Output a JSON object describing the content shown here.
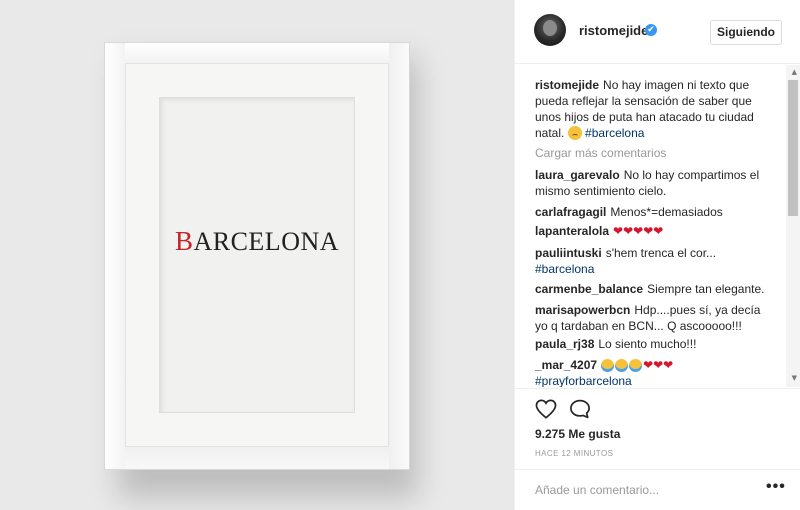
{
  "photo": {
    "artwork_first_letter": "B",
    "artwork_rest": "ARCELONA",
    "accent_color": "#c6232a"
  },
  "header": {
    "username": "ristomejide",
    "verified_icon": "✔",
    "follow_label": "Siguiendo"
  },
  "caption": {
    "user": "ristomejide",
    "text": "No hay imagen ni texto que pueda reflejar la sensación de saber que unos hijos de puta han atacado tu ciudad natal.",
    "hashtag": "#barcelona"
  },
  "load_more": "Cargar más comentarios",
  "comments": [
    {
      "user": "laura_garevalo",
      "text": "No lo hay compartimos el mismo sentimiento cielo."
    },
    {
      "user": "carlafragagil",
      "text": "Menos*=demasiados"
    },
    {
      "user": "lapanteralola",
      "text": "❤❤❤❤❤"
    },
    {
      "user": "pauliintuski",
      "text": "s'hem trenca el cor...",
      "hashtag": "#barcelona"
    },
    {
      "user": "carmenbe_balance",
      "text": "Siempre tan elegante."
    },
    {
      "user": "marisapowerbcn",
      "text": "Hdp....pues sí, ya decía yo q tardaban en BCN... Q ascooooo!!!"
    },
    {
      "user": "paula_rj38",
      "text": "Lo siento mucho!!!"
    },
    {
      "user": "_mar_4207",
      "text": "❤❤❤",
      "hashtag": "#prayforbarcelona"
    }
  ],
  "actions": {
    "likes": "9.275 Me gusta",
    "time": "HACE 12 MINUTOS"
  },
  "add_comment": {
    "placeholder": "Añade un comentario...",
    "more_label": "•••"
  },
  "colors": {
    "link": "#003569",
    "verified": "#3897f0",
    "muted": "#999999"
  }
}
